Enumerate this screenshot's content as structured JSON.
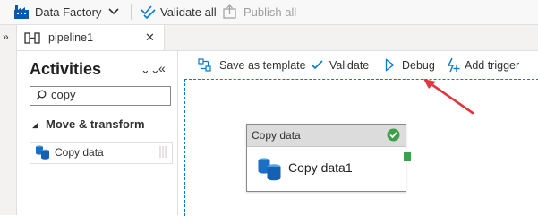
{
  "topbar": {
    "factory_label": "Data Factory",
    "validate_all_label": "Validate all",
    "publish_all_label": "Publish all"
  },
  "tab": {
    "label": "pipeline1",
    "close_glyph": "✕"
  },
  "left_strip": {
    "expand_glyph": "»"
  },
  "activities": {
    "title": "Activities",
    "collapse_glyph": "⌄⌄",
    "hide_glyph": "«",
    "search_value": "copy",
    "category_caret": "◢",
    "category_label": "Move & transform",
    "item_label": "Copy data"
  },
  "toolbar": {
    "save_template_label": "Save as template",
    "validate_label": "Validate",
    "debug_label": "Debug",
    "add_trigger_label": "Add trigger"
  },
  "node": {
    "type_label": "Copy data",
    "name": "Copy data1",
    "status": "succeeded"
  },
  "colors": {
    "accent": "#0078d4",
    "success": "#3ea04a",
    "annotation_arrow": "#e0383e"
  }
}
